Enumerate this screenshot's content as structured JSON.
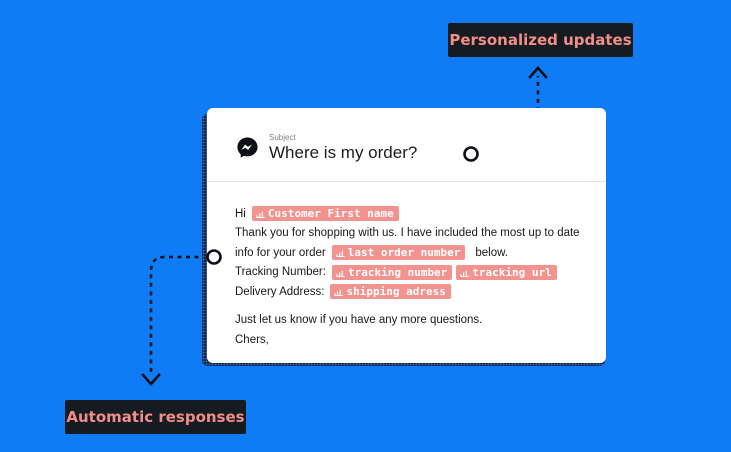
{
  "callouts": {
    "top": "Personalized updates",
    "bottom": "Automatic responses"
  },
  "message": {
    "subject_label": "Subject",
    "subject": "Where is my order?",
    "greeting": "Hi",
    "line2": "Thank you for shopping with us. I have included the most up to date",
    "line3_prefix": "info for your order",
    "line3_suffix": "below.",
    "tracking_label": "Tracking Number:",
    "delivery_label": "Delivery Address:",
    "closing1": "Just let us know if you have any more questions.",
    "closing2": "Chers,"
  },
  "tags": {
    "first_name": "Customer First name",
    "last_order": "last order number",
    "tracking_number": "tracking number",
    "tracking_url": "tracking url",
    "shipping_address": "shipping adress"
  },
  "colors": {
    "background": "#0f7cf6",
    "label_bg": "#161b22",
    "label_text": "#f08e87",
    "tag_bg": "#f2938f"
  },
  "icons": [
    "messenger-icon",
    "chart-bars-icon"
  ]
}
